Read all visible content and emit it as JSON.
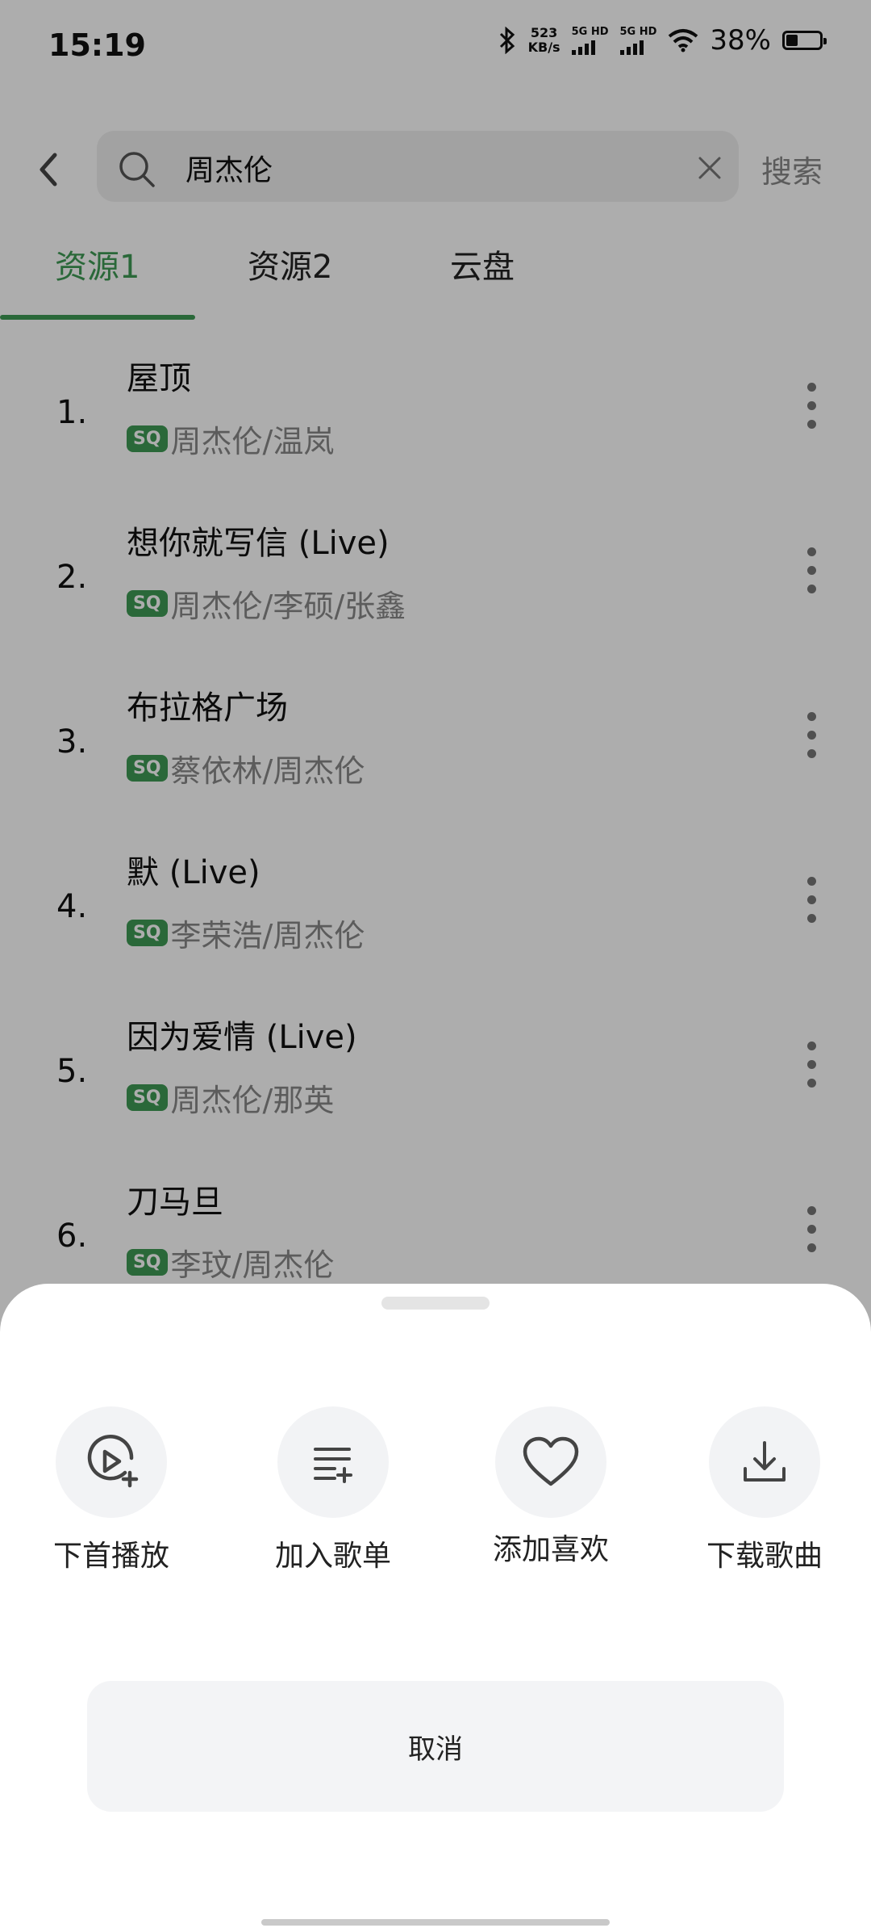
{
  "status_bar": {
    "time": "15:19",
    "net_speed_value": "523",
    "net_speed_unit": "KB/s",
    "sim1_label": "5G HD",
    "sim2_label": "5G HD",
    "battery": "38%"
  },
  "search": {
    "query": "周杰伦",
    "search_button": "搜索"
  },
  "tabs": [
    {
      "label": "资源1",
      "active": true
    },
    {
      "label": "资源2",
      "active": false
    },
    {
      "label": "云盘",
      "active": false
    }
  ],
  "songs": [
    {
      "num": "1.",
      "title": "屋顶",
      "quality": "SQ",
      "artist": "周杰伦/温岚"
    },
    {
      "num": "2.",
      "title": "想你就写信 (Live)",
      "quality": "SQ",
      "artist": "周杰伦/李硕/张鑫"
    },
    {
      "num": "3.",
      "title": "布拉格广场",
      "quality": "SQ",
      "artist": "蔡依林/周杰伦"
    },
    {
      "num": "4.",
      "title": "默 (Live)",
      "quality": "SQ",
      "artist": "李荣浩/周杰伦"
    },
    {
      "num": "5.",
      "title": "因为爱情 (Live)",
      "quality": "SQ",
      "artist": "周杰伦/那英"
    },
    {
      "num": "6.",
      "title": "刀马旦",
      "quality": "SQ",
      "artist": "李玟/周杰伦"
    }
  ],
  "sheet": {
    "actions": [
      {
        "label": "下首播放",
        "icon": "play-next-icon"
      },
      {
        "label": "加入歌单",
        "icon": "add-to-playlist-icon"
      },
      {
        "label": "添加喜欢",
        "icon": "heart-icon"
      },
      {
        "label": "下载歌曲",
        "icon": "download-icon"
      }
    ],
    "cancel": "取消"
  },
  "colors": {
    "accent": "#3e9a54",
    "overlay": "rgba(0,0,0,0.32)"
  }
}
